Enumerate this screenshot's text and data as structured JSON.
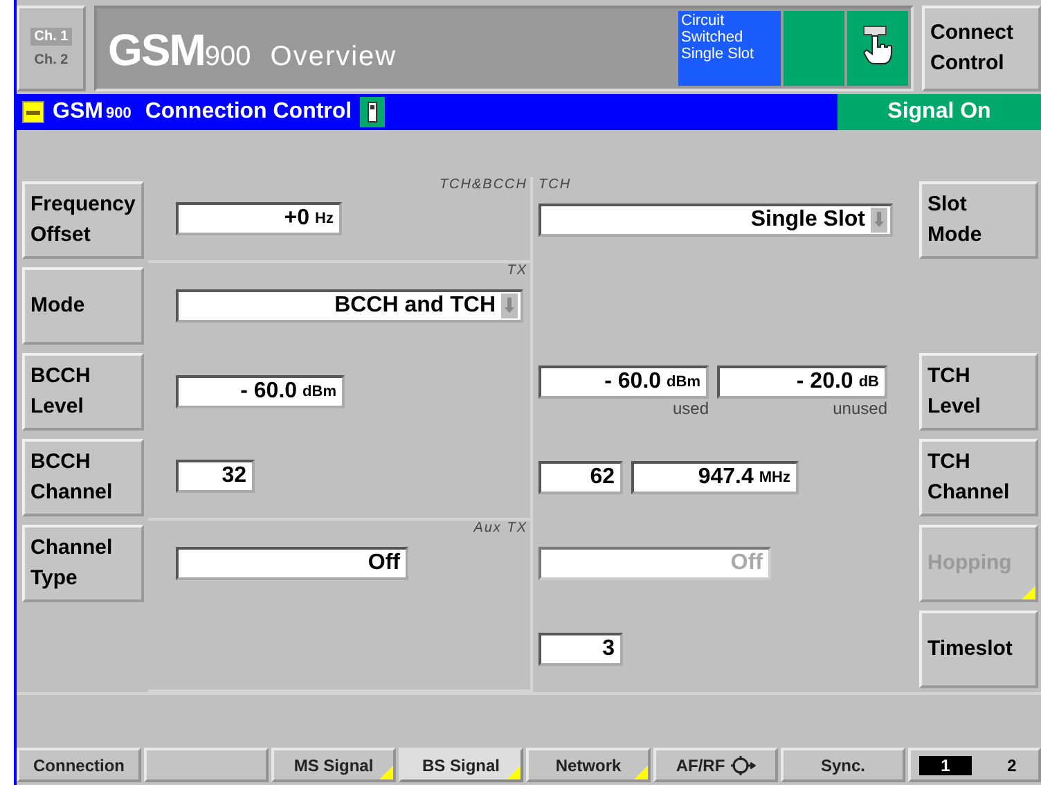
{
  "header": {
    "channels": [
      {
        "label": "Ch. 1",
        "selected": true
      },
      {
        "label": "Ch. 2",
        "selected": false
      }
    ],
    "title": "GSM",
    "band": "900",
    "view": "Overview",
    "status_text": "Circuit Switched Single Slot",
    "indicators": [
      {
        "kind": "blank"
      },
      {
        "kind": "hand"
      }
    ],
    "connect_button": "Connect Control"
  },
  "connection_bar": {
    "title": "GSM",
    "band": "900",
    "subtitle": "Connection Control",
    "signal": "Signal On"
  },
  "rows": [
    {
      "left_button": {
        "label": "Frequency Offset",
        "disabled": false,
        "submenu": false
      },
      "left_tag": "TCH&BCCH",
      "left_fields": [
        {
          "kind": "number",
          "value": "+0",
          "unit": "Hz",
          "disabled": false
        }
      ],
      "right_tag": "TCH",
      "right_fields": [
        {
          "kind": "dropdown",
          "value": "Single Slot",
          "disabled": false
        }
      ],
      "right_button": {
        "label": "Slot Mode",
        "disabled": false,
        "submenu": false
      }
    },
    {
      "left_button": {
        "label": "Mode",
        "disabled": false,
        "submenu": false
      },
      "left_tag": "TX",
      "left_fields": [
        {
          "kind": "dropdown",
          "value": "BCCH and TCH",
          "disabled": false
        }
      ],
      "right_fields": []
    },
    {
      "left_button": {
        "label": "BCCH Level",
        "disabled": false,
        "submenu": false
      },
      "left_fields": [
        {
          "kind": "number",
          "value": "- 60.0",
          "unit": "dBm",
          "disabled": false
        }
      ],
      "right_fields": [
        {
          "kind": "number",
          "value": "- 60.0",
          "unit": "dBm",
          "caption": "used",
          "disabled": false
        },
        {
          "kind": "number",
          "value": "- 20.0",
          "unit": "dB",
          "caption": "unused",
          "disabled": false
        }
      ],
      "right_button": {
        "label": "TCH Level",
        "disabled": false,
        "submenu": false
      }
    },
    {
      "left_button": {
        "label": "BCCH Channel",
        "disabled": false,
        "submenu": false
      },
      "left_fields": [
        {
          "kind": "number",
          "value": "32",
          "disabled": false
        }
      ],
      "right_fields": [
        {
          "kind": "number",
          "value": "62",
          "disabled": false
        },
        {
          "kind": "number",
          "value": "947.4",
          "unit": "MHz",
          "disabled": false
        }
      ],
      "right_button": {
        "label": "TCH Channel",
        "disabled": false,
        "submenu": false
      }
    },
    {
      "left_button": {
        "label": "Channel Type",
        "disabled": false,
        "submenu": false
      },
      "left_tag": "Aux TX",
      "left_fields": [
        {
          "kind": "number",
          "value": "Off",
          "disabled": false
        }
      ],
      "right_fields": [
        {
          "kind": "number",
          "value": "Off",
          "disabled": true
        }
      ],
      "right_button": {
        "label": "Hopping",
        "disabled": true,
        "submenu": true
      }
    },
    {
      "left_fields": [],
      "right_fields": [
        {
          "kind": "number",
          "value": "3",
          "disabled": false
        }
      ],
      "right_button": {
        "label": "Timeslot",
        "disabled": false,
        "submenu": false
      }
    }
  ],
  "tabs": [
    {
      "kind": "tab",
      "label": "Connection",
      "selected": false,
      "submenu": false
    },
    {
      "kind": "blank",
      "selected": false,
      "submenu": false
    },
    {
      "kind": "tab",
      "label": "MS Signal",
      "selected": false,
      "submenu": true
    },
    {
      "kind": "tab",
      "label": "BS Signal",
      "selected": true,
      "submenu": true
    },
    {
      "kind": "tab",
      "label": "Network",
      "selected": false,
      "submenu": true
    },
    {
      "kind": "afrf",
      "label": "AF/RF",
      "selected": false,
      "submenu": false
    },
    {
      "kind": "tab",
      "label": "Sync.",
      "selected": false,
      "submenu": false
    }
  ],
  "pages": [
    {
      "label": "1",
      "selected": true
    },
    {
      "label": "2",
      "selected": false
    }
  ]
}
